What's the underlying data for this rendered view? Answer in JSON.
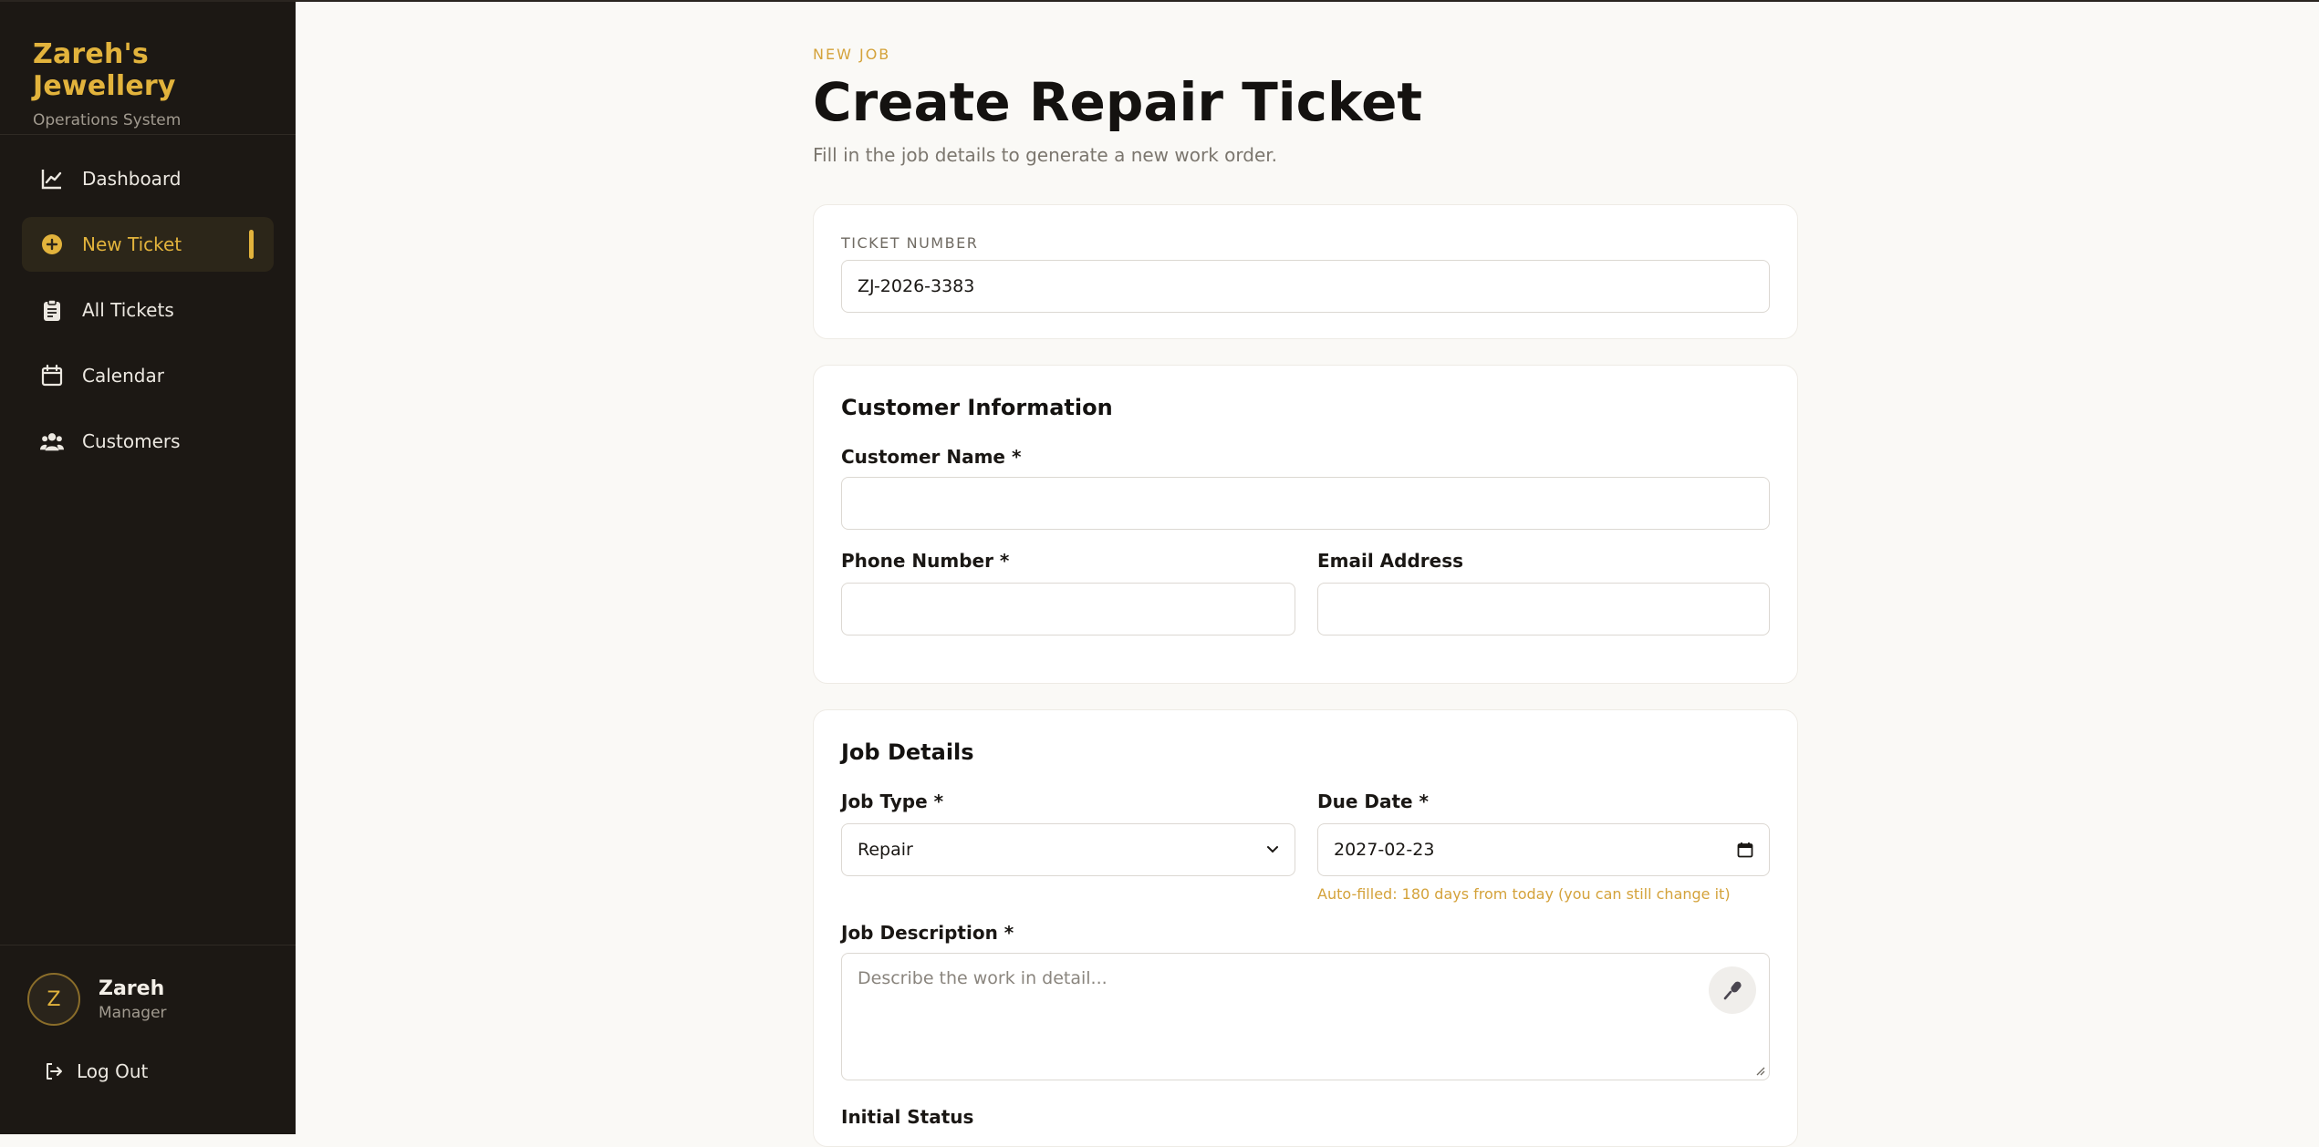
{
  "sidebar": {
    "brand_title": "Zareh's Jewellery",
    "brand_subtitle": "Operations System",
    "items": [
      {
        "label": "Dashboard",
        "icon": "chart-line-icon",
        "active": false
      },
      {
        "label": "New Ticket",
        "icon": "plus-circle-icon",
        "active": true
      },
      {
        "label": "All Tickets",
        "icon": "clipboard-icon",
        "active": false
      },
      {
        "label": "Calendar",
        "icon": "calendar-icon",
        "active": false
      },
      {
        "label": "Customers",
        "icon": "users-icon",
        "active": false
      }
    ],
    "user": {
      "initial": "Z",
      "name": "Zareh",
      "role": "Manager"
    },
    "logout_label": "Log Out"
  },
  "header": {
    "eyebrow": "NEW JOB",
    "title": "Create Repair Ticket",
    "subtitle": "Fill in the job details to generate a new work order."
  },
  "ticket": {
    "label": "TICKET NUMBER",
    "value": "ZJ-2026-3383"
  },
  "customer": {
    "title": "Customer Information",
    "name_label": "Customer Name *",
    "name_value": "",
    "phone_label": "Phone Number *",
    "phone_value": "",
    "email_label": "Email Address",
    "email_value": ""
  },
  "job": {
    "title": "Job Details",
    "type_label": "Job Type *",
    "type_value": "Repair",
    "due_label": "Due Date *",
    "due_value": "2027-02-23",
    "due_hint": "Auto-filled: 180 days from today (you can still change it)",
    "description_label": "Job Description *",
    "description_placeholder": "Describe the work in detail...",
    "status_label": "Initial Status"
  },
  "colors": {
    "accent": "#e2b33c",
    "sidebar_bg": "#1c1814",
    "page_bg": "#faf9f6"
  }
}
